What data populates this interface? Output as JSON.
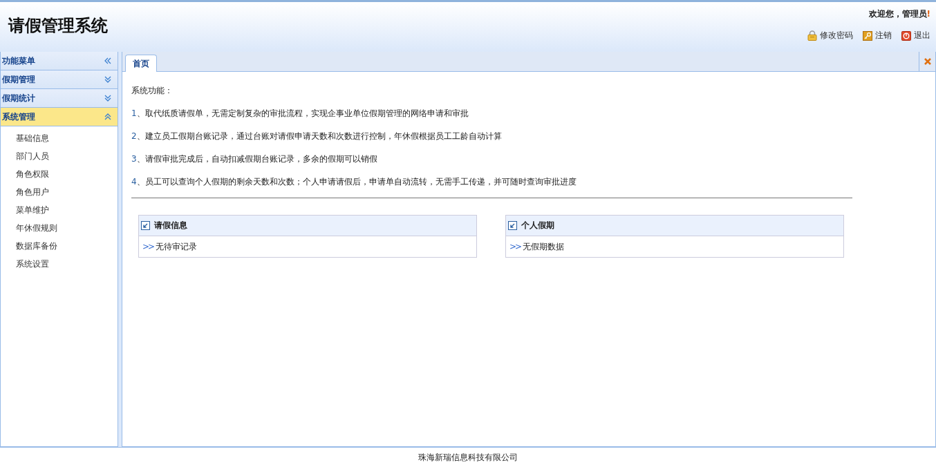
{
  "header": {
    "title": "请假管理系统",
    "welcome": "欢迎您，管理员",
    "welcome_mark": "!",
    "actions": [
      {
        "kind": "lock",
        "label": "修改密码"
      },
      {
        "kind": "key",
        "label": "注销"
      },
      {
        "kind": "power",
        "label": "退出"
      }
    ]
  },
  "sidebar": {
    "title": "功能菜单",
    "sections": [
      {
        "label": "假期管理",
        "expanded": false
      },
      {
        "label": "假期统计",
        "expanded": false
      },
      {
        "label": "系统管理",
        "expanded": true,
        "items": [
          "基础信息",
          "部门人员",
          "角色权限",
          "角色用户",
          "菜单维护",
          "年休假规则",
          "数据库备份",
          "系统设置"
        ]
      }
    ]
  },
  "tabs": [
    {
      "label": "首页",
      "selected": true
    }
  ],
  "content": {
    "heading": "系统功能：",
    "features": [
      {
        "number": "1",
        "text": "、取代纸质请假单，无需定制复杂的审批流程，实现企事业单位假期管理的网络申请和审批"
      },
      {
        "number": "2",
        "text": "、建立员工假期台账记录，通过台账对请假申请天数和次数进行控制，年休假根据员工工龄自动计算"
      },
      {
        "number": "3",
        "text": "、请假审批完成后，自动扣减假期台账记录，多余的假期可以销假"
      },
      {
        "number": "4",
        "text": "、员工可以查询个人假期的剩余天数和次数；个人申请请假后，申请单自动流转，无需手工传递，并可随时查询审批进度"
      }
    ],
    "panels": [
      {
        "title": "请假信息",
        "bullet": ">>",
        "message": "无待审记录"
      },
      {
        "title": "个人假期",
        "bullet": ">>",
        "message": "无假期数据"
      }
    ]
  },
  "footer": "珠海新瑞信息科技有限公司"
}
